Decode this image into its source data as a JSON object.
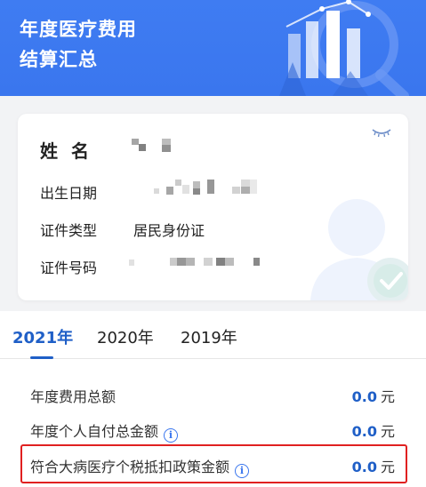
{
  "banner": {
    "title_line1": "年度医疗费用",
    "title_line2": "结算汇总"
  },
  "colors": {
    "primary": "#3a76ee",
    "accent_blue": "#1f5fc7",
    "highlight": "#e02020"
  },
  "card": {
    "name_label": "姓 名",
    "birth_label": "出生日期",
    "idtype_label": "证件类型",
    "idtype_value": "居民身份证",
    "idnum_label": "证件号码",
    "eye_icon": "eye-closed-icon"
  },
  "tabs": [
    {
      "label": "2021年",
      "active": true
    },
    {
      "label": "2020年",
      "active": false
    },
    {
      "label": "2019年",
      "active": false
    }
  ],
  "summary": [
    {
      "label": "年度费用总额",
      "value": "0.0",
      "unit": "元",
      "info": false
    },
    {
      "label": "年度个人自付总金额",
      "value": "0.0",
      "unit": "元",
      "info": true
    },
    {
      "label": "符合大病医疗个税抵扣政策金额",
      "value": "0.0",
      "unit": "元",
      "info": true
    }
  ]
}
